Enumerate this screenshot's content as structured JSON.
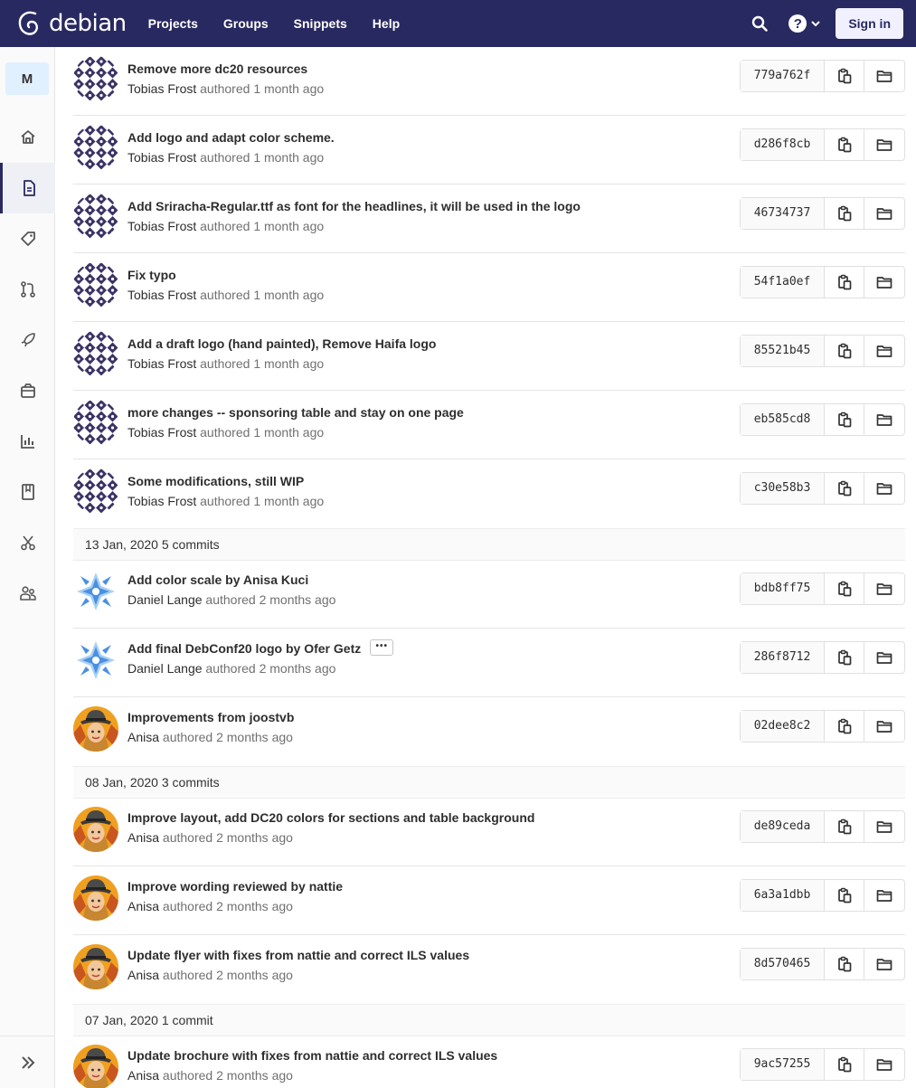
{
  "navbar": {
    "brand": "debian",
    "links": [
      "Projects",
      "Groups",
      "Snippets",
      "Help"
    ],
    "sign_in": "Sign in",
    "help_glyph": "?"
  },
  "sidebar": {
    "project_letter": "M",
    "items": [
      {
        "name": "home-icon"
      },
      {
        "name": "document-icon",
        "active": true
      },
      {
        "name": "tag-icon"
      },
      {
        "name": "merge-request-icon"
      },
      {
        "name": "rocket-icon"
      },
      {
        "name": "package-icon"
      },
      {
        "name": "chart-icon"
      },
      {
        "name": "book-icon"
      },
      {
        "name": "scissors-icon"
      },
      {
        "name": "users-icon"
      }
    ],
    "collapse_icon": "double-chevron-right-icon"
  },
  "commits_top": [
    {
      "title": "Remove more dc20 resources",
      "author": "Tobias Frost",
      "verb": "authored",
      "when": "1 month ago",
      "sha": "779a762f",
      "avatar": "pattern"
    },
    {
      "title": "Add logo and adapt color scheme.",
      "author": "Tobias Frost",
      "verb": "authored",
      "when": "1 month ago",
      "sha": "d286f8cb",
      "avatar": "pattern"
    },
    {
      "title": "Add Sriracha-Regular.ttf as font for the headlines, it will be used in the logo",
      "author": "Tobias Frost",
      "verb": "authored",
      "when": "1 month ago",
      "sha": "46734737",
      "avatar": "pattern"
    },
    {
      "title": "Fix typo",
      "author": "Tobias Frost",
      "verb": "authored",
      "when": "1 month ago",
      "sha": "54f1a0ef",
      "avatar": "pattern"
    },
    {
      "title": "Add a draft logo (hand painted), Remove Haifa logo",
      "author": "Tobias Frost",
      "verb": "authored",
      "when": "1 month ago",
      "sha": "85521b45",
      "avatar": "pattern"
    },
    {
      "title": "more changes -- sponsoring table and stay on one page",
      "author": "Tobias Frost",
      "verb": "authored",
      "when": "1 month ago",
      "sha": "eb585cd8",
      "avatar": "pattern"
    },
    {
      "title": "Some modifications, still WIP",
      "author": "Tobias Frost",
      "verb": "authored",
      "when": "1 month ago",
      "sha": "c30e58b3",
      "avatar": "pattern"
    }
  ],
  "days": [
    {
      "date": "13 Jan, 2020",
      "count": "5 commits",
      "commits": [
        {
          "title": "Add color scale by Anisa Kuci",
          "author": "Daniel Lange",
          "verb": "authored",
          "when": "2 months ago",
          "sha": "bdb8ff75",
          "avatar": "blue"
        },
        {
          "title": "Add final DebConf20 logo by Ofer Getz",
          "author": "Daniel Lange",
          "verb": "authored",
          "when": "2 months ago",
          "sha": "286f8712",
          "avatar": "blue",
          "ellipsis": "•••"
        },
        {
          "title": "Improvements from joostvb",
          "author": "Anisa",
          "verb": "authored",
          "when": "2 months ago",
          "sha": "02dee8c2",
          "avatar": "person"
        }
      ]
    },
    {
      "date": "08 Jan, 2020",
      "count": "3 commits",
      "commits": [
        {
          "title": "Improve layout, add DC20 colors for sections and table background",
          "author": "Anisa",
          "verb": "authored",
          "when": "2 months ago",
          "sha": "de89ceda",
          "avatar": "person"
        },
        {
          "title": "Improve wording reviewed by nattie",
          "author": "Anisa",
          "verb": "authored",
          "when": "2 months ago",
          "sha": "6a3a1dbb",
          "avatar": "person"
        },
        {
          "title": "Update flyer with fixes from nattie and correct ILS values",
          "author": "Anisa",
          "verb": "authored",
          "when": "2 months ago",
          "sha": "8d570465",
          "avatar": "person"
        }
      ]
    },
    {
      "date": "07 Jan, 2020",
      "count": "1 commit",
      "commits": [
        {
          "title": "Update brochure with fixes from nattie and correct ILS values",
          "author": "Anisa",
          "verb": "authored",
          "when": "2 months ago",
          "sha": "9ac57255",
          "avatar": "person"
        }
      ]
    }
  ],
  "icons": {
    "copy": "clipboard-icon",
    "browse": "folder-icon"
  },
  "colors": {
    "navbar": "#292961",
    "avatar_pattern": "#3b3365",
    "avatar_blue": "#4a90e2"
  }
}
